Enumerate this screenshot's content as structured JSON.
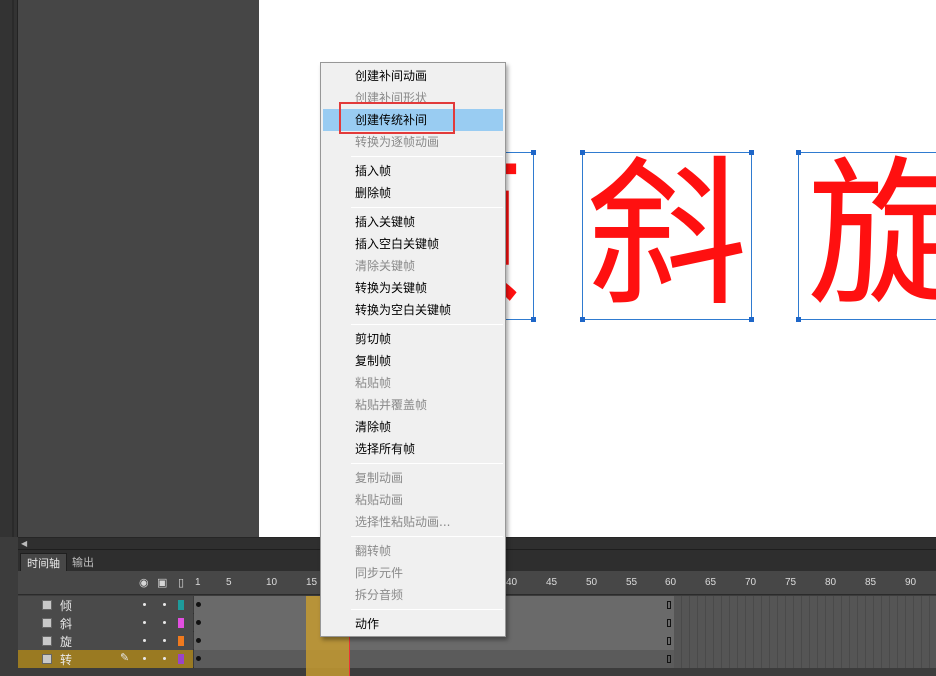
{
  "stage": {
    "glyphs": [
      "倾",
      "斜",
      "旋"
    ],
    "glyph_color": "#ff1010"
  },
  "context_menu": {
    "items": [
      {
        "label": "创建补间动画",
        "enabled": true
      },
      {
        "label": "创建补间形状",
        "enabled": false
      },
      {
        "label": "创建传统补间",
        "enabled": true,
        "highlighted": true
      },
      {
        "label": "转换为逐帧动画",
        "enabled": false
      },
      {
        "label": "插入帧",
        "enabled": true
      },
      {
        "label": "删除帧",
        "enabled": true
      },
      {
        "label": "插入关键帧",
        "enabled": true
      },
      {
        "label": "插入空白关键帧",
        "enabled": true
      },
      {
        "label": "清除关键帧",
        "enabled": false
      },
      {
        "label": "转换为关键帧",
        "enabled": true
      },
      {
        "label": "转换为空白关键帧",
        "enabled": true
      },
      {
        "label": "剪切帧",
        "enabled": true
      },
      {
        "label": "复制帧",
        "enabled": true
      },
      {
        "label": "粘贴帧",
        "enabled": false
      },
      {
        "label": "粘贴并覆盖帧",
        "enabled": false
      },
      {
        "label": "清除帧",
        "enabled": true
      },
      {
        "label": "选择所有帧",
        "enabled": true
      },
      {
        "label": "复制动画",
        "enabled": false
      },
      {
        "label": "粘贴动画",
        "enabled": false
      },
      {
        "label": "选择性粘贴动画...",
        "enabled": false
      },
      {
        "label": "翻转帧",
        "enabled": false
      },
      {
        "label": "同步元件",
        "enabled": false
      },
      {
        "label": "拆分音频",
        "enabled": false
      },
      {
        "label": "动作",
        "enabled": true
      }
    ]
  },
  "timeline": {
    "tabs": [
      "时间轴",
      "输出"
    ],
    "active_tab": "时间轴",
    "ruler": [
      "1",
      "5",
      "10",
      "15",
      "40",
      "45",
      "50",
      "55",
      "60",
      "65",
      "70",
      "75",
      "80",
      "85",
      "90"
    ],
    "layers": [
      {
        "name": "倾",
        "color": "#1e9b9b",
        "selected": false
      },
      {
        "name": "斜",
        "color": "#e24fe0",
        "selected": false
      },
      {
        "name": "旋",
        "color": "#f07a1e",
        "selected": false
      },
      {
        "name": "转",
        "color": "#9a44c8",
        "selected": true
      }
    ]
  }
}
